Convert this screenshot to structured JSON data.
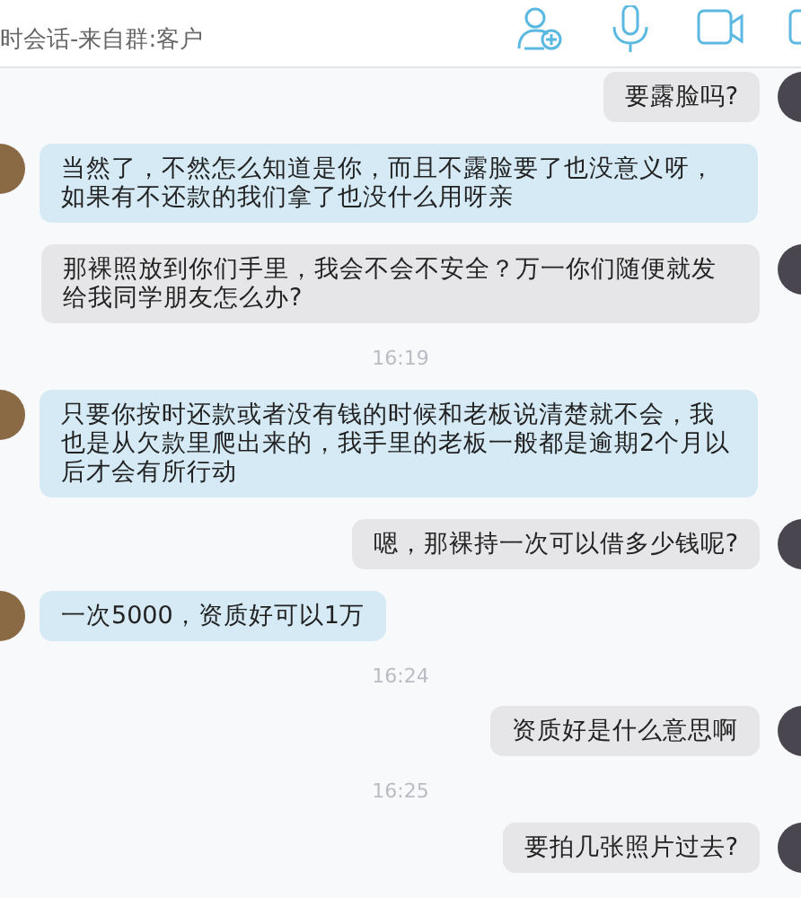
{
  "header": {
    "subtitle": "时会话-来自群:客户"
  },
  "messages": [
    {
      "kind": "sent",
      "text": "要露脸吗?"
    },
    {
      "kind": "received",
      "text": "当然了，不然怎么知道是你，而且不露脸要了也没意义呀，如果有不还款的我们拿了也没什么用呀亲"
    },
    {
      "kind": "sent",
      "text": "那裸照放到你们手里，我会不会不安全？万一你们随便就发给我同学朋友怎么办?"
    },
    {
      "kind": "time",
      "text": "16:19"
    },
    {
      "kind": "received",
      "text": "只要你按时还款或者没有钱的时候和老板说清楚就不会，我也是从欠款里爬出来的，我手里的老板一般都是逾期2个月以后才会有所行动"
    },
    {
      "kind": "sent",
      "text": "嗯，那裸持一次可以借多少钱呢?"
    },
    {
      "kind": "received",
      "text": "一次5000，资质好可以1万"
    },
    {
      "kind": "time",
      "text": "16:24"
    },
    {
      "kind": "sent",
      "text": "资质好是什么意思啊"
    },
    {
      "kind": "time",
      "text": "16:25"
    },
    {
      "kind": "sent",
      "text": "要拍几张照片过去?"
    }
  ]
}
